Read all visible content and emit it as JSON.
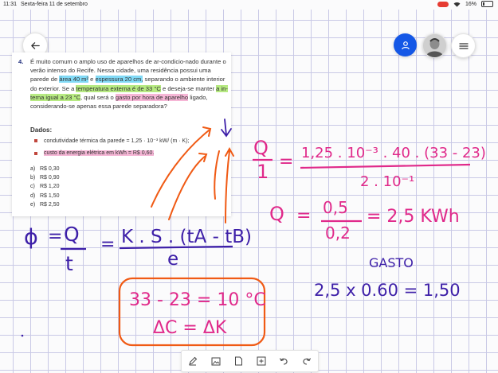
{
  "status_bar": {
    "time": "11:31",
    "date": "Sexta-feira 11 de setembro",
    "battery": "16%"
  },
  "question": {
    "number": "4.",
    "text_parts": [
      "É muito comum o amplo uso de aparelhos de ar-condicio-nado durante o verão intenso do Recife. Nessa cidade, uma residência possui uma parede de ",
      "área 40 m²",
      " e ",
      "espessura 20 cm,",
      " separando o ambiente interior do exterior. Se a ",
      "temperatura externa é de 33 °C",
      " e deseja-se manter ",
      "a in-terna igual a 23 °C",
      ", qual será o ",
      "gasto por hora de aparelho",
      " ligado, considerando-se apenas essa parede separadora?"
    ],
    "dados_label": "Dados:",
    "dados": [
      "condutividade térmica da parede = 1,25 · 10⁻³ kW/ (m · K);",
      "custo da energia elétrica em kWh = R$ 0,60."
    ],
    "options": [
      {
        "letter": "a)",
        "value": "R$ 0,30"
      },
      {
        "letter": "b)",
        "value": "R$ 0,90"
      },
      {
        "letter": "c)",
        "value": "R$ 1,20"
      },
      {
        "letter": "d)",
        "value": "R$ 1,50"
      },
      {
        "letter": "e)",
        "value": "R$ 2,50"
      }
    ]
  },
  "annotations": {
    "phi": "ϕ",
    "eq1": "=",
    "Q": "Q",
    "t": "t",
    "eq2": "=",
    "formula_num": "K . S . (tA - tB)",
    "formula_den": "e",
    "box_line1": "33 - 23 = 10 °C",
    "box_line2": "ΔC = ΔK",
    "q_over_1_num": "Q",
    "q_over_1_den": "1",
    "eq3": "=",
    "calc_num": "1,25 . 10⁻³ . 40 . (33 - 23)",
    "calc_den": "2 . 10⁻¹",
    "q2": "Q",
    "eq4": "=",
    "frac_num": "0,5",
    "frac_den": "0,2",
    "result": "= 2,5 KWh",
    "gasto_label": "GASTO",
    "gasto_calc": "2,5 x 0.60 = 1,50"
  },
  "icons": {
    "back": "back-arrow-icon",
    "user": "user-icon",
    "avatar": "avatar-photo",
    "menu": "menu-icon",
    "pen": "pen-icon",
    "image": "image-icon",
    "page": "page-icon",
    "add": "add-page-icon",
    "undo": "undo-icon",
    "redo": "redo-icon"
  },
  "colors": {
    "ink_purple": "#3d1fa8",
    "ink_orange": "#f05a14",
    "ink_pink": "#e0298a",
    "accent_blue": "#1457e6"
  }
}
